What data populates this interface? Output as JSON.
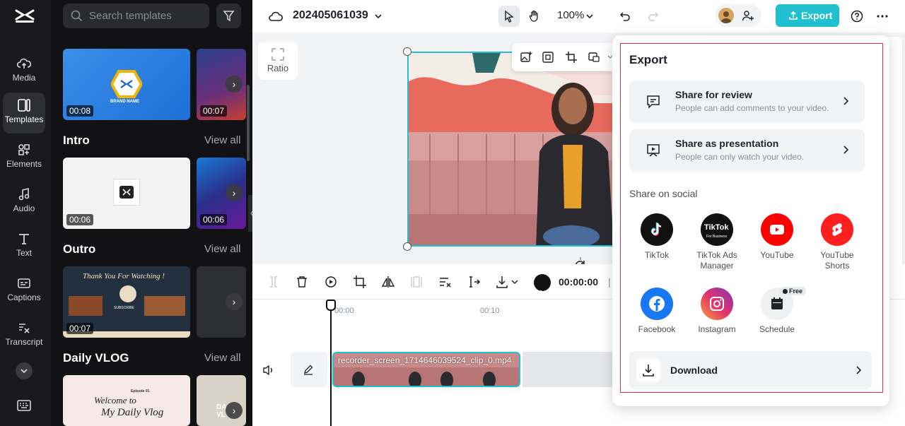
{
  "nav": {
    "items": [
      {
        "label": "Media",
        "icon": "cloud-upload-icon"
      },
      {
        "label": "Templates",
        "icon": "templates-icon"
      },
      {
        "label": "Elements",
        "icon": "elements-icon"
      },
      {
        "label": "Audio",
        "icon": "music-note-icon"
      },
      {
        "label": "Text",
        "icon": "text-icon"
      },
      {
        "label": "Captions",
        "icon": "captions-icon"
      },
      {
        "label": "Transcript",
        "icon": "transcript-icon"
      }
    ],
    "active": "Templates"
  },
  "templates": {
    "search_placeholder": "Search templates",
    "sections": [
      {
        "title": "Intro",
        "view_all": "View all"
      },
      {
        "title": "Outro",
        "view_all": "View all"
      },
      {
        "title": "Daily VLOG",
        "view_all": "View all"
      }
    ],
    "thumbs": {
      "row0": [
        "00:08",
        "00:07"
      ],
      "row1": [
        "00:06",
        "00:06"
      ],
      "row2": [
        "00:07"
      ],
      "brand_name": "BRAND NAME",
      "thank_you": "Thank You For Watching !",
      "subscribe": "SUBSCRIBE",
      "welcome": "Welcome to",
      "my_daily_vlog": "My Daily Vlog",
      "episode": "Episode 01",
      "daily_partial": "DA VL"
    }
  },
  "topbar": {
    "project_name": "202405061039",
    "zoom": "100%",
    "export_label": "Export"
  },
  "canvas": {
    "ratio_label": "Ratio"
  },
  "timeline": {
    "timecode": "00:00:00",
    "timecode_sep": "| 0",
    "ticks": [
      "00:00",
      "00:10"
    ],
    "clip_name": "recorder_screen_1714646039524_clip_0.mp4"
  },
  "export": {
    "title": "Export",
    "share_review": {
      "title": "Share for review",
      "desc": "People can add comments to your video."
    },
    "share_presentation": {
      "title": "Share as presentation",
      "desc": "People can only watch your video."
    },
    "social_title": "Share on social",
    "social": [
      {
        "label": "TikTok",
        "icon": "tiktok-icon",
        "color": "#111111"
      },
      {
        "label": "TikTok Ads Manager",
        "icon": "tiktok-business-icon",
        "color": "#111111"
      },
      {
        "label": "YouTube",
        "icon": "youtube-icon",
        "color": "#ff0000"
      },
      {
        "label": "YouTube Shorts",
        "icon": "youtube-shorts-icon",
        "color": "#ff1f1f"
      },
      {
        "label": "Facebook",
        "icon": "facebook-icon",
        "color": "#1877f2"
      },
      {
        "label": "Instagram",
        "icon": "instagram-icon",
        "color": "#e1306c"
      },
      {
        "label": "Schedule",
        "icon": "calendar-icon",
        "color": "#eef0f2"
      }
    ],
    "tiktok_business_text": "TikTok",
    "tiktok_business_sub": "For Business",
    "free_badge": "Free",
    "download_label": "Download"
  },
  "colors": {
    "accent": "#21c0d0",
    "highlight_outline": "#d9363e"
  }
}
